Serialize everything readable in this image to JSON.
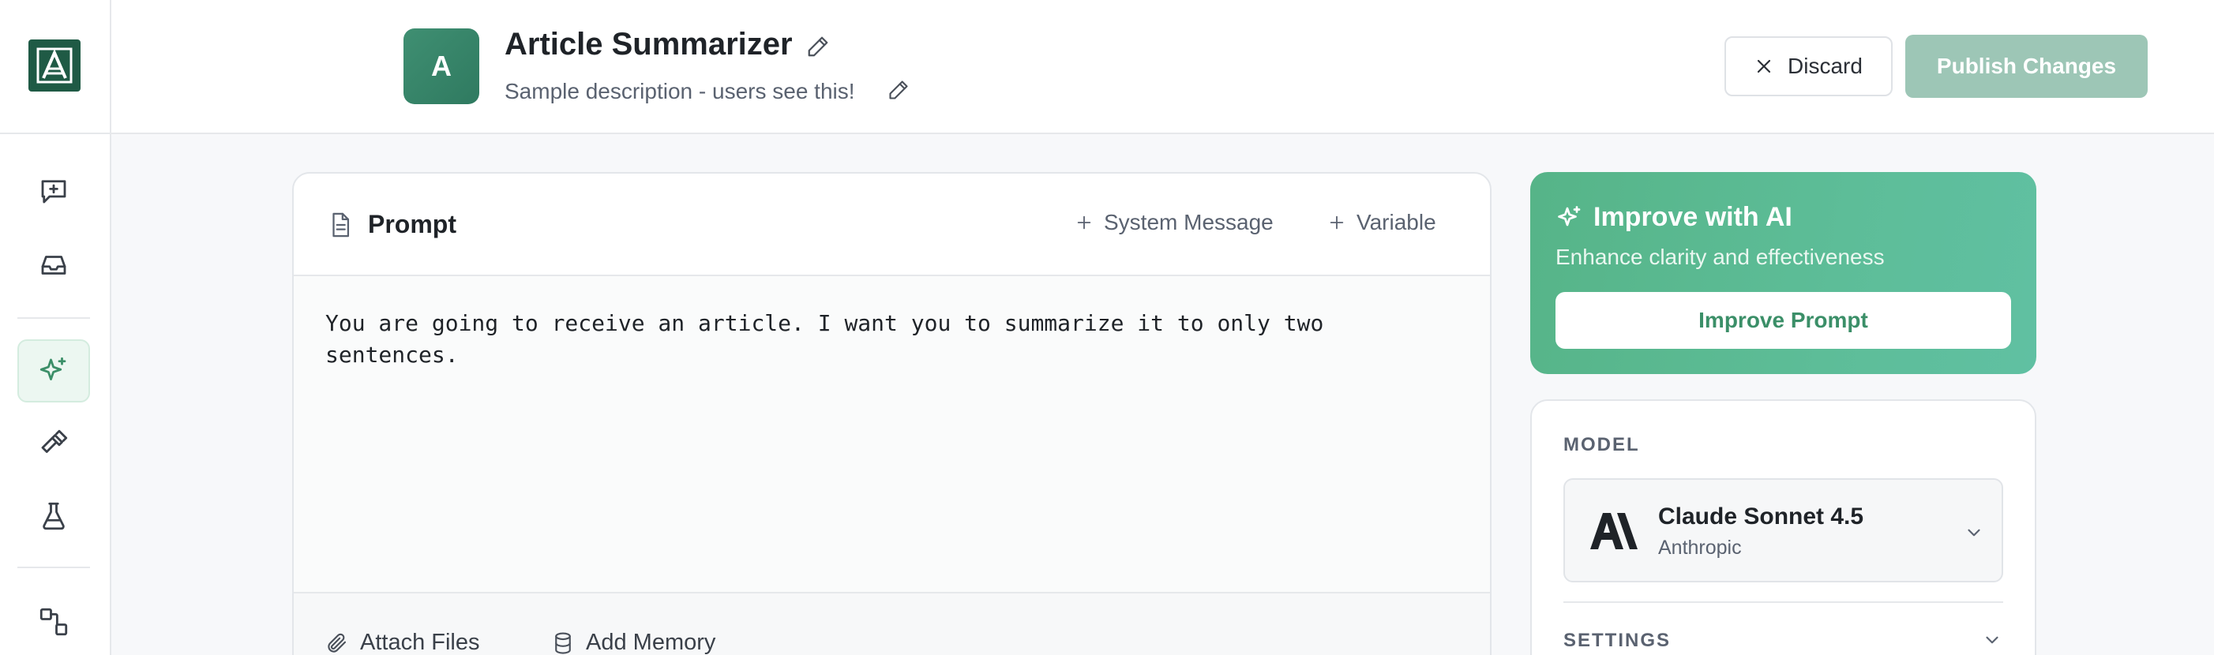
{
  "header": {
    "avatar_letter": "A",
    "title": "Article Summarizer",
    "description": "Sample description - users see this!",
    "discard_label": "Discard",
    "publish_label": "Publish Changes"
  },
  "sidebar": {
    "items": [
      {
        "icon": "new-chat-icon"
      },
      {
        "icon": "inbox-icon"
      },
      {
        "icon": "sparkles-icon",
        "active": true
      },
      {
        "icon": "hammer-icon"
      },
      {
        "icon": "flask-icon"
      },
      {
        "icon": "workflow-icon"
      }
    ]
  },
  "prompt": {
    "title": "Prompt",
    "system_message_label": "System Message",
    "variable_label": "Variable",
    "text": "You are going to receive an article. I want you to summarize it to only two\nsentences.",
    "attach_files_label": "Attach Files",
    "add_memory_label": "Add Memory"
  },
  "improve": {
    "title": "Improve with AI",
    "subtitle": "Enhance clarity and effectiveness",
    "button_label": "Improve Prompt"
  },
  "model": {
    "section_label": "MODEL",
    "name": "Claude Sonnet 4.5",
    "provider": "Anthropic",
    "settings_label": "SETTINGS"
  },
  "colors": {
    "brand": "#1f5a45",
    "accent_green": "#56b488",
    "publish_disabled": "#9dc6b6",
    "active_rail_bg": "#ecf7f1"
  }
}
